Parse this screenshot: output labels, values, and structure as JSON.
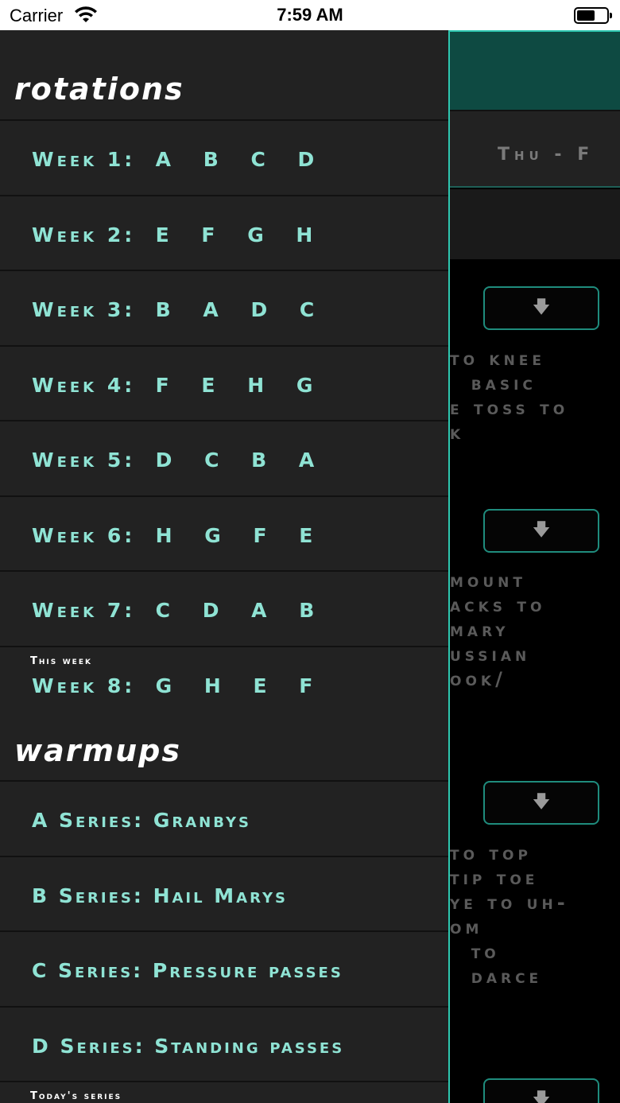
{
  "status_bar": {
    "carrier": "Carrier",
    "time": "7:59 AM"
  },
  "background": {
    "day_label": "Thu - F",
    "text_blocks": [
      "to knee\n  basic\ne toss to\nk",
      "mount\nacks to\nmary\nussian\nook/",
      "to top\ntip toe\nye to uh-\nom\n  to\n  darce"
    ]
  },
  "drawer": {
    "rotations_title": "rotations",
    "weeks": [
      {
        "label": "Week 1:",
        "letters": "A B C D"
      },
      {
        "label": "Week 2:",
        "letters": "E F G H"
      },
      {
        "label": "Week 3:",
        "letters": "B A D C"
      },
      {
        "label": "Week 4:",
        "letters": "F E H G"
      },
      {
        "label": "Week 5:",
        "letters": "D C B A"
      },
      {
        "label": "Week 6:",
        "letters": "H G F E"
      },
      {
        "label": "Week 7:",
        "letters": "C D A B"
      },
      {
        "label": "Week 8:",
        "letters": "G H E F",
        "badge": "This week"
      }
    ],
    "warmups_title": "warmups",
    "series": [
      {
        "label": "A Series: Granbys"
      },
      {
        "label": "B Series: Hail Marys"
      },
      {
        "label": "C Series: Pressure passes"
      },
      {
        "label": "D Series: Standing passes"
      },
      {
        "label": "",
        "badge": "Today's series"
      }
    ]
  }
}
